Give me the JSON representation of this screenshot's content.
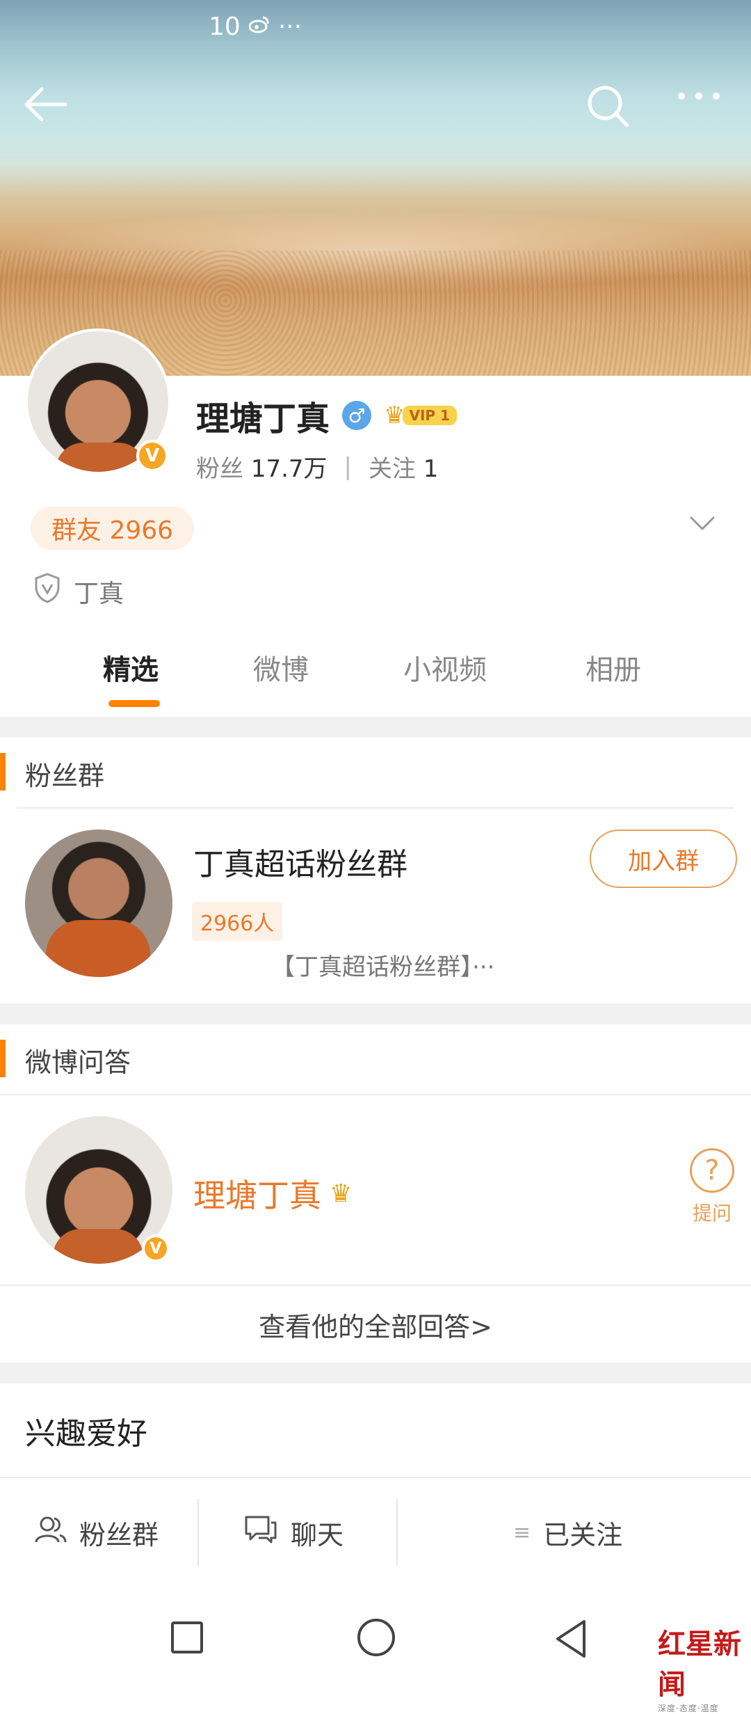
{
  "status_bar": {
    "time": "10",
    "more": "···"
  },
  "profile": {
    "name": "理塘丁真",
    "gender_symbol": "♂",
    "vip_label": "VIP 1",
    "verified_symbol": "V",
    "fans_label": "粉丝",
    "fans_count": "17.7万",
    "follow_label": "关注",
    "follow_count": "1",
    "group_chip": "群友 2966",
    "verification_text": "丁真"
  },
  "tabs": [
    "精选",
    "微博",
    "小视频",
    "相册"
  ],
  "fan_group_section": {
    "title": "粉丝群",
    "group_name": "丁真超话粉丝群",
    "member_count": "2966人",
    "description": "【丁真超话粉丝群】···",
    "join_button": "加入群"
  },
  "qa_section": {
    "title": "微博问答",
    "name": "理塘丁真",
    "ask_label": "提问",
    "ask_symbol": "?",
    "all_answers_link": "查看他的全部回答>"
  },
  "interests": {
    "title": "兴趣爱好"
  },
  "action_bar": {
    "fan_group": "粉丝群",
    "chat": "聊天",
    "followed": "已关注",
    "followed_icon": "≡"
  },
  "watermark": {
    "text": "红星新闻",
    "sub": "深度·态度·温度"
  },
  "colors": {
    "accent": "#ff8200",
    "orange_text": "#e8792b",
    "vip_gold": "#f7d24a",
    "male_blue": "#5aa6e8"
  }
}
